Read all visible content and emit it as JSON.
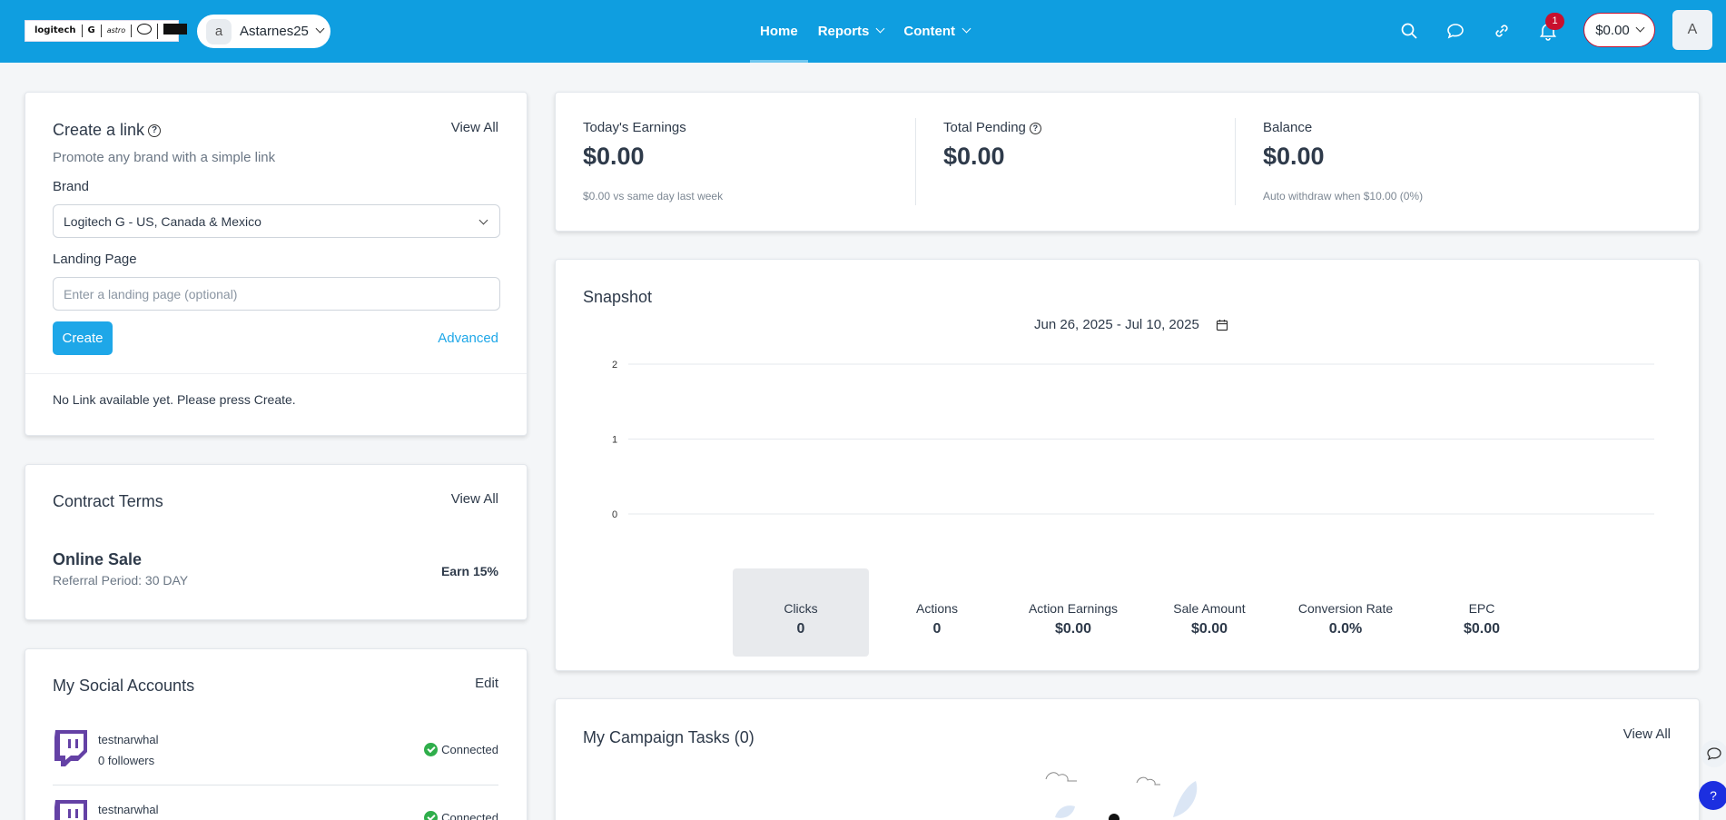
{
  "header": {
    "brand_logos": [
      "logitech",
      "G",
      "astro",
      "Blue",
      "ULTIMATE EARS"
    ],
    "account": {
      "initial": "a",
      "name": "Astarnes25"
    },
    "nav": [
      {
        "label": "Home",
        "active": true
      },
      {
        "label": "Reports",
        "dropdown": true
      },
      {
        "label": "Content",
        "dropdown": true
      }
    ],
    "icons": [
      "search-icon",
      "chat-icon",
      "link-icon",
      "bell-icon"
    ],
    "notification_count": "1",
    "balance": "$0.00",
    "user_initial": "A"
  },
  "create_link": {
    "title": "Create a link",
    "view_all": "View All",
    "subtitle": "Promote any brand with a simple link",
    "brand_label": "Brand",
    "brand_value": "Logitech G - US, Canada & Mexico",
    "landing_label": "Landing Page",
    "landing_placeholder": "Enter a landing page (optional)",
    "create_button": "Create",
    "advanced": "Advanced",
    "empty_message": "No Link available yet. Please press Create."
  },
  "contract_terms": {
    "title": "Contract Terms",
    "view_all": "View All",
    "tier": "Online Sale",
    "referral": "Referral Period: 30 DAY",
    "earn": "Earn 15%"
  },
  "social": {
    "title": "My Social Accounts",
    "edit": "Edit",
    "accounts": [
      {
        "name": "testnarwhal",
        "followers": "0 followers",
        "status": "Connected",
        "platform": "twitch-icon"
      },
      {
        "name": "testnarwhal",
        "followers": "",
        "status": "Connected",
        "platform": "twitch-icon"
      }
    ]
  },
  "earnings": {
    "today_label": "Today's Earnings",
    "today_value": "$0.00",
    "today_note": "$0.00 vs same day last week",
    "pending_label": "Total Pending",
    "pending_value": "$0.00",
    "balance_label": "Balance",
    "balance_value": "$0.00",
    "balance_note": "Auto withdraw when $10.00 (0%)"
  },
  "snapshot": {
    "title": "Snapshot",
    "date_range": "Jun 26, 2025 - Jul 10, 2025",
    "stats": [
      {
        "label": "Clicks",
        "value": "0",
        "active": true
      },
      {
        "label": "Actions",
        "value": "0"
      },
      {
        "label": "Action Earnings",
        "value": "$0.00"
      },
      {
        "label": "Sale Amount",
        "value": "$0.00"
      },
      {
        "label": "Conversion Rate",
        "value": "0.0%"
      },
      {
        "label": "EPC",
        "value": "$0.00"
      }
    ]
  },
  "chart_data": {
    "type": "line",
    "x": [],
    "series": [
      {
        "values": []
      }
    ],
    "ylim": [
      0,
      2
    ],
    "yticks": [
      "2",
      "1",
      "0"
    ],
    "grid": true
  },
  "campaign_tasks": {
    "title": "My Campaign Tasks (0)",
    "view_all": "View All"
  },
  "colors": {
    "header_bg": "#0f9ee0",
    "primary": "#1ea7e8",
    "badge": "#c8102e",
    "connected": "#2fae4b",
    "twitch": "#6441a5"
  }
}
